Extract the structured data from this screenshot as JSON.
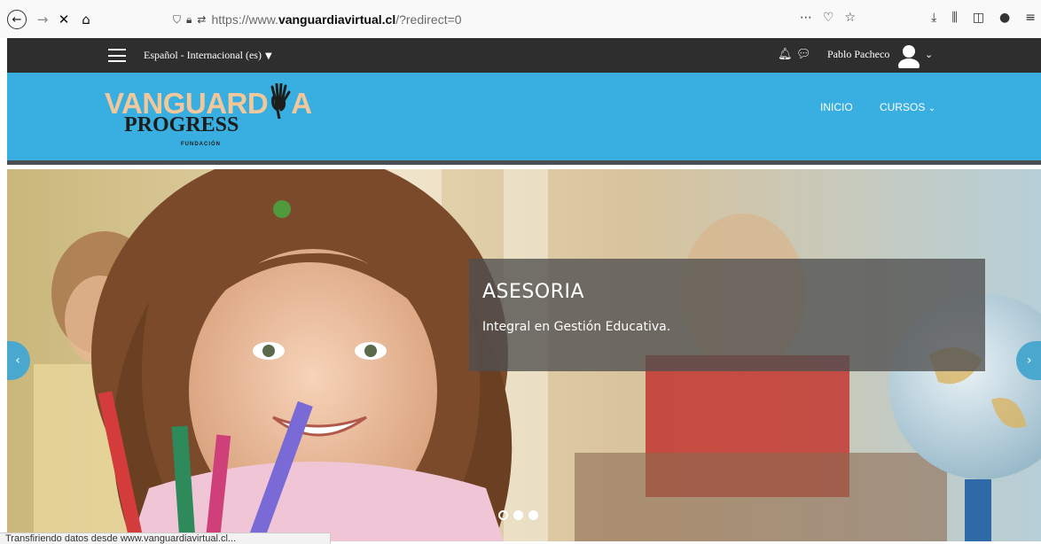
{
  "browser": {
    "url_prefix": "https://www.",
    "url_domain": "vanguardiavirtual.cl",
    "url_path": "/?redirect=0",
    "status_text": "Transfiriendo datos desde www.vanguardiavirtual.cl..."
  },
  "topnav": {
    "language": "Español - Internacional (es)",
    "username": "Pablo Pacheco"
  },
  "header": {
    "logo_text_top": "VANGUARD",
    "logo_text_top_end": "A",
    "logo_text_mid": "PROGRESS",
    "logo_text_bottom": "FUNDACIÓN",
    "menu_inicio": "INICIO",
    "menu_cursos": "CURSOS"
  },
  "carousel": {
    "title": "ASESORIA",
    "subtitle": "Integral en Gestión Educativa.",
    "slide_count": 3,
    "active_slide": 1
  },
  "colors": {
    "header_blue": "#39aee0",
    "navbar_dark": "#2e2e2e",
    "logo_peach": "#f2c79a"
  }
}
